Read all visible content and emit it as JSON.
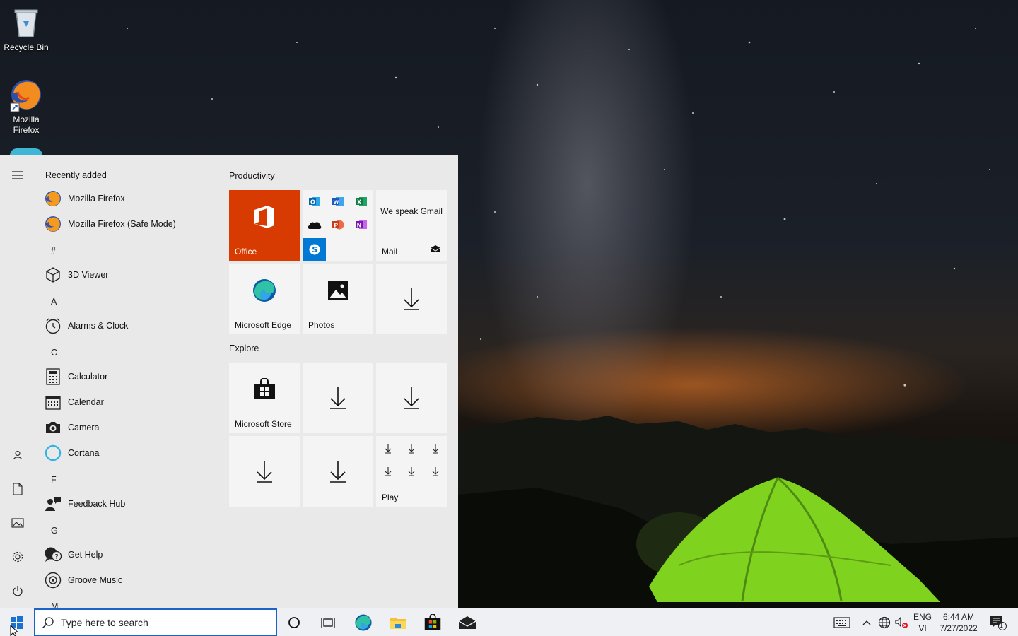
{
  "desktop": {
    "icons": [
      {
        "label": "Recycle Bin"
      },
      {
        "label": "Mozilla Firefox"
      }
    ]
  },
  "start_menu": {
    "recently_added_label": "Recently added",
    "recent_apps": [
      {
        "label": "Mozilla Firefox",
        "icon": "firefox-icon"
      },
      {
        "label": "Mozilla Firefox (Safe Mode)",
        "icon": "firefox-icon"
      }
    ],
    "sections": [
      {
        "letter": "#",
        "apps": [
          {
            "label": "3D Viewer",
            "icon": "cube-icon"
          }
        ]
      },
      {
        "letter": "A",
        "apps": [
          {
            "label": "Alarms & Clock",
            "icon": "clock-icon"
          }
        ]
      },
      {
        "letter": "C",
        "apps": [
          {
            "label": "Calculator",
            "icon": "calculator-icon"
          },
          {
            "label": "Calendar",
            "icon": "calendar-icon"
          },
          {
            "label": "Camera",
            "icon": "camera-icon"
          },
          {
            "label": "Cortana",
            "icon": "cortana-ring-icon"
          }
        ]
      },
      {
        "letter": "F",
        "apps": [
          {
            "label": "Feedback Hub",
            "icon": "feedback-person-icon"
          }
        ]
      },
      {
        "letter": "G",
        "apps": [
          {
            "label": "Get Help",
            "icon": "help-bubble-icon"
          },
          {
            "label": "Groove Music",
            "icon": "music-disc-icon"
          }
        ]
      },
      {
        "letter": "M",
        "apps": []
      }
    ],
    "tile_groups": [
      {
        "title": "Productivity"
      },
      {
        "title": "Explore"
      }
    ],
    "tiles": {
      "office": "Office",
      "mail_tagline": "We speak Gmail",
      "mail": "Mail",
      "edge": "Microsoft Edge",
      "photos": "Photos",
      "store": "Microsoft Store",
      "play": "Play"
    },
    "colors": {
      "office_tile": "#d83b01",
      "skype": "#0078d4",
      "menu_bg": "#e9e9e9",
      "accent": "#1a63c9"
    }
  },
  "taskbar": {
    "search_placeholder": "Type here to search",
    "language_top": "ENG",
    "language_bottom": "VI",
    "time": "6:44 AM",
    "date": "7/27/2022",
    "notification_count": "1"
  }
}
